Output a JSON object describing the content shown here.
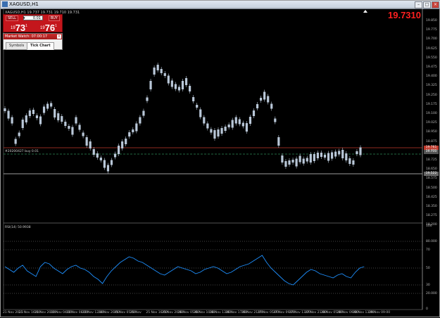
{
  "window": {
    "title": "XAGUSD,H1",
    "buttons": [
      "minimize",
      "maximize",
      "close"
    ]
  },
  "chart": {
    "symbol": "XAGUSD",
    "ohlc_text": "XAGUSD,H1  19.737 19.731 19.710 19.731",
    "current_price": "19.7310",
    "trade_panel": {
      "sell_label": "SELL",
      "buy_label": "BUY",
      "volume": "0.01",
      "sell_price": {
        "prefix": "19",
        "big": "73",
        "sup": "1"
      },
      "buy_price": {
        "prefix": "19",
        "big": "76",
        "sup": "1"
      }
    },
    "market_watch": {
      "title": "Market Watch: 07:00:17",
      "tabs": [
        "Symbols",
        "Tick Chart"
      ],
      "active_tab": "Tick Chart"
    },
    "price_axis": [
      "19.850",
      "19.775",
      "19.700",
      "19.625",
      "19.550",
      "19.475",
      "19.400",
      "19.325",
      "19.250",
      "19.175",
      "19.100",
      "19.025",
      "18.950",
      "18.875",
      "18.800",
      "18.725",
      "18.650",
      "18.575",
      "18.500",
      "18.425",
      "18.350",
      "18.275",
      "18.200"
    ],
    "order_label": "#20200427 buy 0.01",
    "price_tags": {
      "ask": "19.761",
      "bid": "19.731",
      "low_line": "19.522"
    },
    "colors": {
      "candle": "#b9c7d8",
      "bid_line": "#c0392b",
      "rsi_line": "#1e90ff",
      "order_line": "#2e8b57"
    }
  },
  "rsi": {
    "title": "RSI(14) 50.9938",
    "axis": [
      "100",
      "80.000",
      "70",
      "50",
      "30",
      "20.000",
      "0"
    ]
  },
  "time_axis": [
    "21 Nov 2015",
    "21 Nov 16:00",
    "21 Nov 20:00",
    "22 Nov 04:00",
    "22 Nov 08:00",
    "22 Nov 12:00",
    "24 Nov 20:00",
    "25 Nov 05:00",
    "25 Nov",
    "25 Nov 16:00",
    "25 Nov 20:00",
    "26 Nov 05:00",
    "26 Nov 10:00",
    "26 Nov 13:00",
    "26 Nov 17:00",
    "26 Nov 21:00",
    "27 Nov 05:00",
    "27 Nov 09:00",
    "27 Nov 13:00",
    "27 Nov 21:00",
    "28 Nov 05:00",
    "28 Nov 09:00",
    "28 Nov 13:00",
    "29 Nov 09:00"
  ]
}
